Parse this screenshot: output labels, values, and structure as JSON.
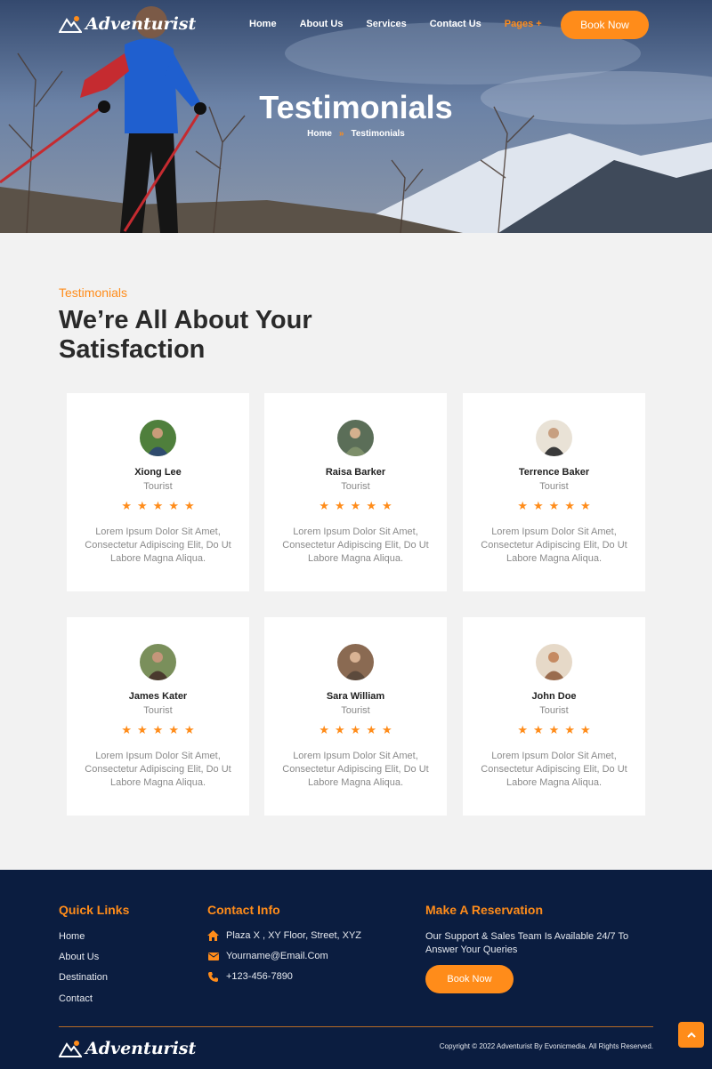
{
  "brand": {
    "name": "Adventurist",
    "accent": "#ff8c1a",
    "footer_bg": "#0b1d40"
  },
  "nav": {
    "links": [
      "Home",
      "About Us",
      "Services",
      "Contact Us",
      "Pages +"
    ],
    "active_index": 4,
    "book_label": "Book Now"
  },
  "hero": {
    "title": "Testimonials",
    "breadcrumb": {
      "home": "Home",
      "separator": "»",
      "current": "Testimonials"
    }
  },
  "section": {
    "subtitle": "Testimonials",
    "title": "We’re All About Your Satisfaction"
  },
  "testimonials": [
    {
      "name": "Xiong Lee",
      "role": "Tourist",
      "rating": 5,
      "text": "Lorem Ipsum Dolor Sit Amet, Consectetur Adipiscing Elit, Do Ut Labore Magna Aliqua."
    },
    {
      "name": "Raisa Barker",
      "role": "Tourist",
      "rating": 5,
      "text": "Lorem Ipsum Dolor Sit Amet, Consectetur Adipiscing Elit, Do Ut Labore Magna Aliqua."
    },
    {
      "name": "Terrence Baker",
      "role": "Tourist",
      "rating": 5,
      "text": "Lorem Ipsum Dolor Sit Amet, Consectetur Adipiscing Elit, Do Ut Labore Magna Aliqua."
    },
    {
      "name": "James Kater",
      "role": "Tourist",
      "rating": 5,
      "text": "Lorem Ipsum Dolor Sit Amet, Consectetur Adipiscing Elit, Do Ut Labore Magna Aliqua."
    },
    {
      "name": "Sara William",
      "role": "Tourist",
      "rating": 5,
      "text": "Lorem Ipsum Dolor Sit Amet, Consectetur Adipiscing Elit, Do Ut Labore Magna Aliqua."
    },
    {
      "name": "John Doe",
      "role": "Tourist",
      "rating": 5,
      "text": "Lorem Ipsum Dolor Sit Amet, Consectetur Adipiscing Elit, Do Ut Labore Magna Aliqua."
    }
  ],
  "footer": {
    "quick_links": {
      "heading": "Quick Links",
      "items": [
        "Home",
        "About Us",
        "Destination",
        "Contact"
      ]
    },
    "contact": {
      "heading": "Contact Info",
      "address": "Plaza X , XY Floor, Street, XYZ",
      "email": "Yourname@Email.Com",
      "phone": "+123-456-7890",
      "icons": [
        "home-icon",
        "envelope-icon",
        "phone-icon"
      ]
    },
    "reservation": {
      "heading": "Make A Reservation",
      "text": "Our Support & Sales Team Is Available 24/7 To Answer Your Queries",
      "button": "Book Now"
    },
    "copyright": "Copyright © 2022 Adventurist By Evonicmedia. All Rights Reserved."
  },
  "scroll_top_icon": "chevron-up-icon"
}
